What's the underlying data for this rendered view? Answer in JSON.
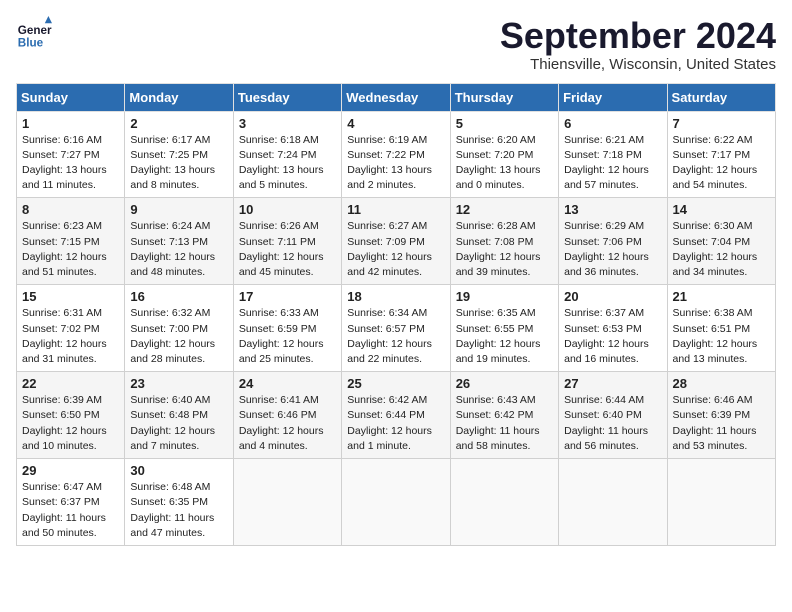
{
  "header": {
    "logo_line1": "General",
    "logo_line2": "Blue",
    "month": "September 2024",
    "location": "Thiensville, Wisconsin, United States"
  },
  "days_of_week": [
    "Sunday",
    "Monday",
    "Tuesday",
    "Wednesday",
    "Thursday",
    "Friday",
    "Saturday"
  ],
  "weeks": [
    [
      {
        "day": "1",
        "info": "Sunrise: 6:16 AM\nSunset: 7:27 PM\nDaylight: 13 hours and 11 minutes."
      },
      {
        "day": "2",
        "info": "Sunrise: 6:17 AM\nSunset: 7:25 PM\nDaylight: 13 hours and 8 minutes."
      },
      {
        "day": "3",
        "info": "Sunrise: 6:18 AM\nSunset: 7:24 PM\nDaylight: 13 hours and 5 minutes."
      },
      {
        "day": "4",
        "info": "Sunrise: 6:19 AM\nSunset: 7:22 PM\nDaylight: 13 hours and 2 minutes."
      },
      {
        "day": "5",
        "info": "Sunrise: 6:20 AM\nSunset: 7:20 PM\nDaylight: 13 hours and 0 minutes."
      },
      {
        "day": "6",
        "info": "Sunrise: 6:21 AM\nSunset: 7:18 PM\nDaylight: 12 hours and 57 minutes."
      },
      {
        "day": "7",
        "info": "Sunrise: 6:22 AM\nSunset: 7:17 PM\nDaylight: 12 hours and 54 minutes."
      }
    ],
    [
      {
        "day": "8",
        "info": "Sunrise: 6:23 AM\nSunset: 7:15 PM\nDaylight: 12 hours and 51 minutes."
      },
      {
        "day": "9",
        "info": "Sunrise: 6:24 AM\nSunset: 7:13 PM\nDaylight: 12 hours and 48 minutes."
      },
      {
        "day": "10",
        "info": "Sunrise: 6:26 AM\nSunset: 7:11 PM\nDaylight: 12 hours and 45 minutes."
      },
      {
        "day": "11",
        "info": "Sunrise: 6:27 AM\nSunset: 7:09 PM\nDaylight: 12 hours and 42 minutes."
      },
      {
        "day": "12",
        "info": "Sunrise: 6:28 AM\nSunset: 7:08 PM\nDaylight: 12 hours and 39 minutes."
      },
      {
        "day": "13",
        "info": "Sunrise: 6:29 AM\nSunset: 7:06 PM\nDaylight: 12 hours and 36 minutes."
      },
      {
        "day": "14",
        "info": "Sunrise: 6:30 AM\nSunset: 7:04 PM\nDaylight: 12 hours and 34 minutes."
      }
    ],
    [
      {
        "day": "15",
        "info": "Sunrise: 6:31 AM\nSunset: 7:02 PM\nDaylight: 12 hours and 31 minutes."
      },
      {
        "day": "16",
        "info": "Sunrise: 6:32 AM\nSunset: 7:00 PM\nDaylight: 12 hours and 28 minutes."
      },
      {
        "day": "17",
        "info": "Sunrise: 6:33 AM\nSunset: 6:59 PM\nDaylight: 12 hours and 25 minutes."
      },
      {
        "day": "18",
        "info": "Sunrise: 6:34 AM\nSunset: 6:57 PM\nDaylight: 12 hours and 22 minutes."
      },
      {
        "day": "19",
        "info": "Sunrise: 6:35 AM\nSunset: 6:55 PM\nDaylight: 12 hours and 19 minutes."
      },
      {
        "day": "20",
        "info": "Sunrise: 6:37 AM\nSunset: 6:53 PM\nDaylight: 12 hours and 16 minutes."
      },
      {
        "day": "21",
        "info": "Sunrise: 6:38 AM\nSunset: 6:51 PM\nDaylight: 12 hours and 13 minutes."
      }
    ],
    [
      {
        "day": "22",
        "info": "Sunrise: 6:39 AM\nSunset: 6:50 PM\nDaylight: 12 hours and 10 minutes."
      },
      {
        "day": "23",
        "info": "Sunrise: 6:40 AM\nSunset: 6:48 PM\nDaylight: 12 hours and 7 minutes."
      },
      {
        "day": "24",
        "info": "Sunrise: 6:41 AM\nSunset: 6:46 PM\nDaylight: 12 hours and 4 minutes."
      },
      {
        "day": "25",
        "info": "Sunrise: 6:42 AM\nSunset: 6:44 PM\nDaylight: 12 hours and 1 minute."
      },
      {
        "day": "26",
        "info": "Sunrise: 6:43 AM\nSunset: 6:42 PM\nDaylight: 11 hours and 58 minutes."
      },
      {
        "day": "27",
        "info": "Sunrise: 6:44 AM\nSunset: 6:40 PM\nDaylight: 11 hours and 56 minutes."
      },
      {
        "day": "28",
        "info": "Sunrise: 6:46 AM\nSunset: 6:39 PM\nDaylight: 11 hours and 53 minutes."
      }
    ],
    [
      {
        "day": "29",
        "info": "Sunrise: 6:47 AM\nSunset: 6:37 PM\nDaylight: 11 hours and 50 minutes."
      },
      {
        "day": "30",
        "info": "Sunrise: 6:48 AM\nSunset: 6:35 PM\nDaylight: 11 hours and 47 minutes."
      },
      {
        "day": "",
        "info": ""
      },
      {
        "day": "",
        "info": ""
      },
      {
        "day": "",
        "info": ""
      },
      {
        "day": "",
        "info": ""
      },
      {
        "day": "",
        "info": ""
      }
    ]
  ]
}
